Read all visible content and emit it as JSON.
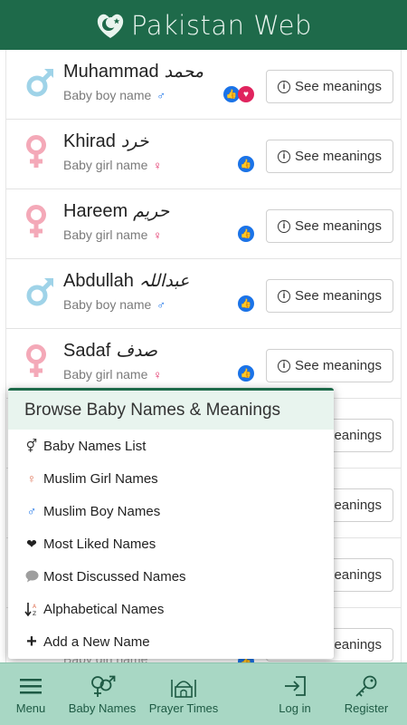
{
  "app": {
    "brand": "Pakistan Web"
  },
  "rows": [
    {
      "name": "Muhammad",
      "urdu": "محمد",
      "gender": "boy",
      "subtitle": "Baby boy name",
      "gender_glyph": "♂",
      "reactions": [
        "like",
        "love"
      ],
      "button": "See meanings"
    },
    {
      "name": "Khirad",
      "urdu": "خرد",
      "gender": "girl",
      "subtitle": "Baby girl name",
      "gender_glyph": "♀",
      "reactions": [
        "like"
      ],
      "button": "See meanings"
    },
    {
      "name": "Hareem",
      "urdu": "حریم",
      "gender": "girl",
      "subtitle": "Baby girl name",
      "gender_glyph": "♀",
      "reactions": [
        "like"
      ],
      "button": "See meanings"
    },
    {
      "name": "Abdullah",
      "urdu": "عبداللہ",
      "gender": "boy",
      "subtitle": "Baby boy name",
      "gender_glyph": "♂",
      "reactions": [
        "like"
      ],
      "button": "See meanings"
    },
    {
      "name": "Sadaf",
      "urdu": "صدف",
      "gender": "girl",
      "subtitle": "Baby girl name",
      "gender_glyph": "♀",
      "reactions": [
        "like"
      ],
      "button": "See meanings"
    }
  ],
  "hidden_rows": [
    {
      "button_partial": "eanings"
    },
    {
      "button_partial": "eanings"
    },
    {
      "button_partial": "eanings"
    },
    {
      "button_partial": "eanings",
      "subtitle_partial": "Baby girl name"
    }
  ],
  "menu": {
    "title": "Browse Baby Names & Meanings",
    "items": [
      {
        "label": "Baby Names List",
        "icon": "gender-pair-icon"
      },
      {
        "label": "Muslim Girl Names",
        "icon": "female-icon"
      },
      {
        "label": "Muslim Boy Names",
        "icon": "male-icon"
      },
      {
        "label": "Most Liked Names",
        "icon": "heart-icon"
      },
      {
        "label": "Most Discussed Names",
        "icon": "comment-icon"
      },
      {
        "label": "Alphabetical Names",
        "icon": "sort-alpha-icon"
      },
      {
        "label": "Add a New Name",
        "icon": "plus-icon"
      }
    ]
  },
  "bottom_nav": [
    {
      "label": "Menu",
      "icon": "hamburger-icon"
    },
    {
      "label": "Baby Names",
      "icon": "gender-icon"
    },
    {
      "label": "Prayer Times",
      "icon": "mosque-icon"
    },
    {
      "label": "Log in",
      "icon": "login-icon"
    },
    {
      "label": "Register",
      "icon": "key-icon"
    }
  ],
  "colors": {
    "header": "#1e6a4a",
    "boy": "#9fd3e8",
    "girl": "#f4a9b8",
    "like": "#1a73e8",
    "love": "#e0245e",
    "nav": "#a8d7c4"
  }
}
